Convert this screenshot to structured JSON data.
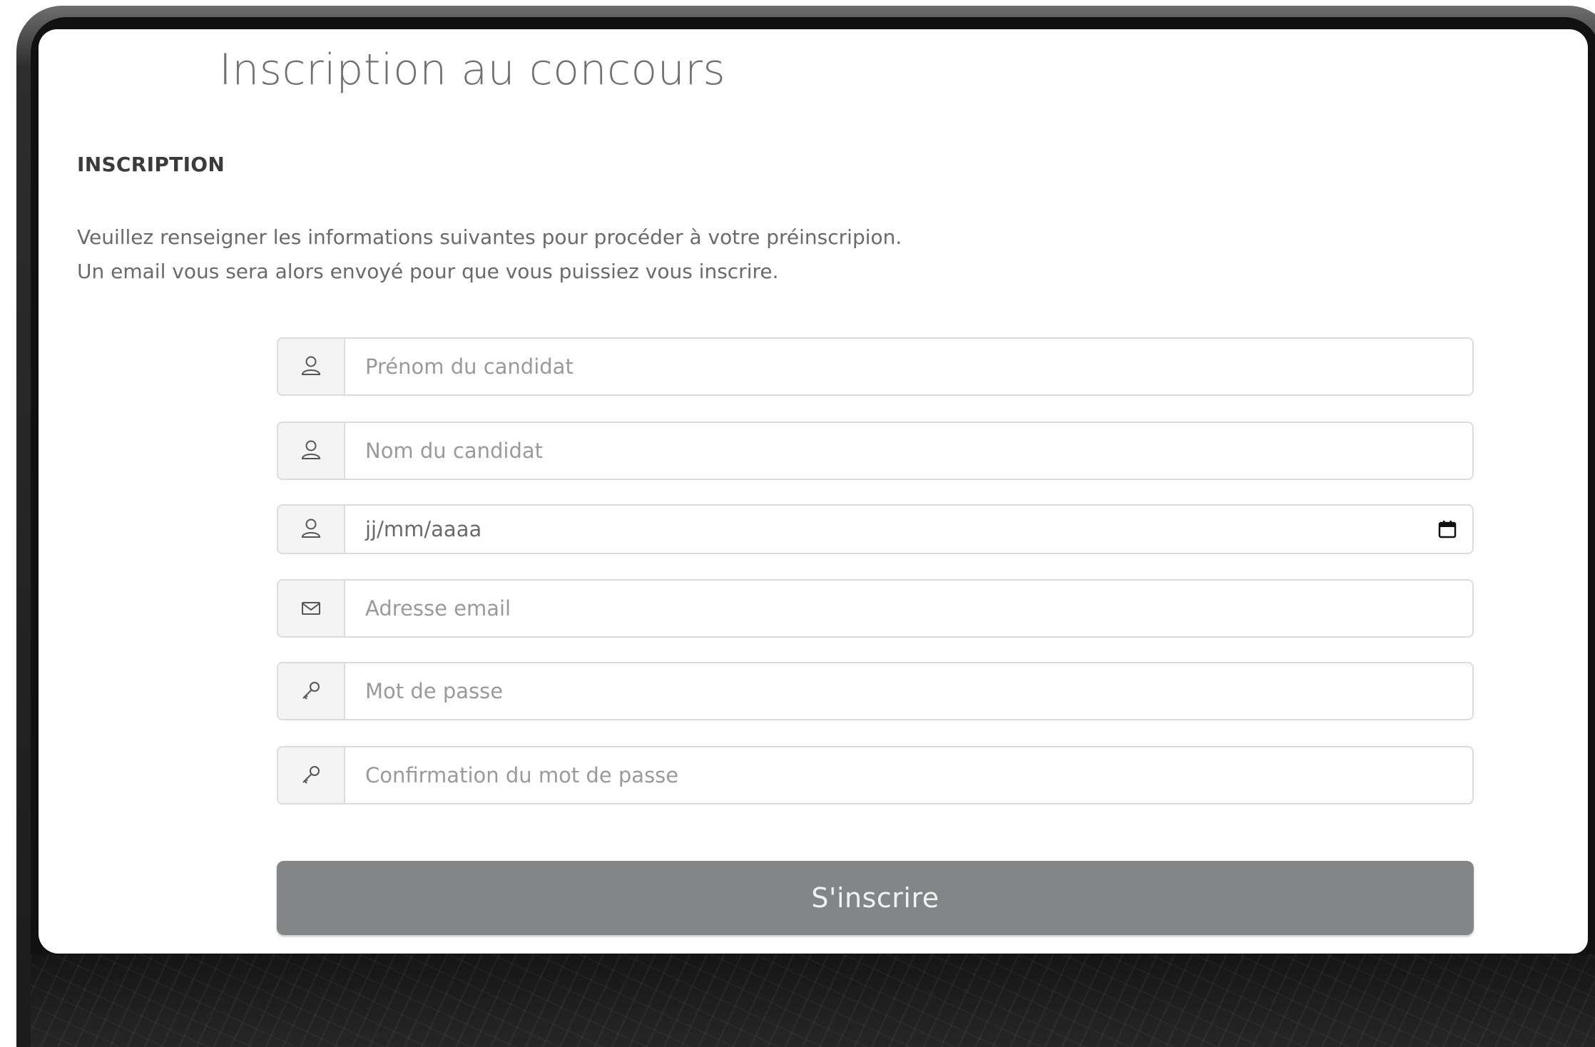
{
  "page": {
    "title": "Inscription au concours",
    "section_heading": "INSCRIPTION",
    "intro_lines": [
      "Veuillez renseigner les informations suivantes pour procéder à votre préinscripion.",
      "Un email vous sera alors envoyé pour que vous puissiez vous inscrire."
    ]
  },
  "form": {
    "first_name": {
      "placeholder": "Prénom du candidat",
      "icon": "user-icon"
    },
    "last_name": {
      "placeholder": "Nom du candidat",
      "icon": "user-icon"
    },
    "birth_date": {
      "placeholder": "jj/mm/aaaa",
      "icon": "user-icon",
      "picker_icon": "calendar-icon"
    },
    "email": {
      "placeholder": "Adresse email",
      "icon": "envelope-icon"
    },
    "password": {
      "placeholder": "Mot de passe",
      "icon": "key-icon"
    },
    "password_confirm": {
      "placeholder": "Confirmation du mot de passe",
      "icon": "key-icon"
    },
    "submit_label": "S'inscrire"
  },
  "colors": {
    "submit_bg": "#848586",
    "title_text": "#707070",
    "border": "#dcdcdc"
  }
}
